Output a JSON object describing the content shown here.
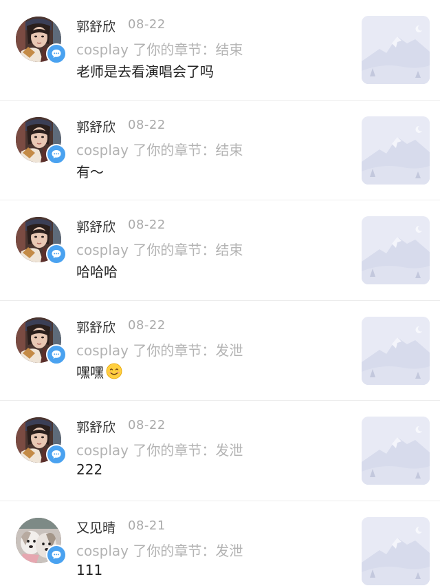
{
  "notifications": [
    {
      "name": "郭舒欣",
      "date": "08-22",
      "action": "cosplay 了你的章节：结束",
      "comment": "老师是去看演唱会了吗",
      "avatar": "girl-avatar",
      "emoji": ""
    },
    {
      "name": "郭舒欣",
      "date": "08-22",
      "action": "cosplay 了你的章节：结束",
      "comment": "有～",
      "avatar": "girl-avatar",
      "emoji": ""
    },
    {
      "name": "郭舒欣",
      "date": "08-22",
      "action": "cosplay 了你的章节：结束",
      "comment": "哈哈哈",
      "avatar": "girl-avatar",
      "emoji": ""
    },
    {
      "name": "郭舒欣",
      "date": "08-22",
      "action": "cosplay 了你的章节：发泄",
      "comment": "嘿嘿",
      "avatar": "girl-avatar",
      "emoji": "smiling-face-emoji"
    },
    {
      "name": "郭舒欣",
      "date": "08-22",
      "action": "cosplay 了你的章节：发泄",
      "comment": "222",
      "avatar": "girl-avatar",
      "emoji": ""
    },
    {
      "name": "又见晴",
      "date": "08-21",
      "action": "cosplay 了你的章节：发泄",
      "comment": "111",
      "avatar": "dog-avatar",
      "emoji": ""
    }
  ],
  "icons": {
    "badge": "comment-bubble-icon",
    "thumbnail": "mountain-placeholder-icon"
  },
  "colors": {
    "badge": "#4aa2f0",
    "name": "#333333",
    "date": "#aaaaaa",
    "action": "#b3b3b3",
    "comment": "#222222",
    "thumbnail_bg": "#e9ebf5"
  }
}
